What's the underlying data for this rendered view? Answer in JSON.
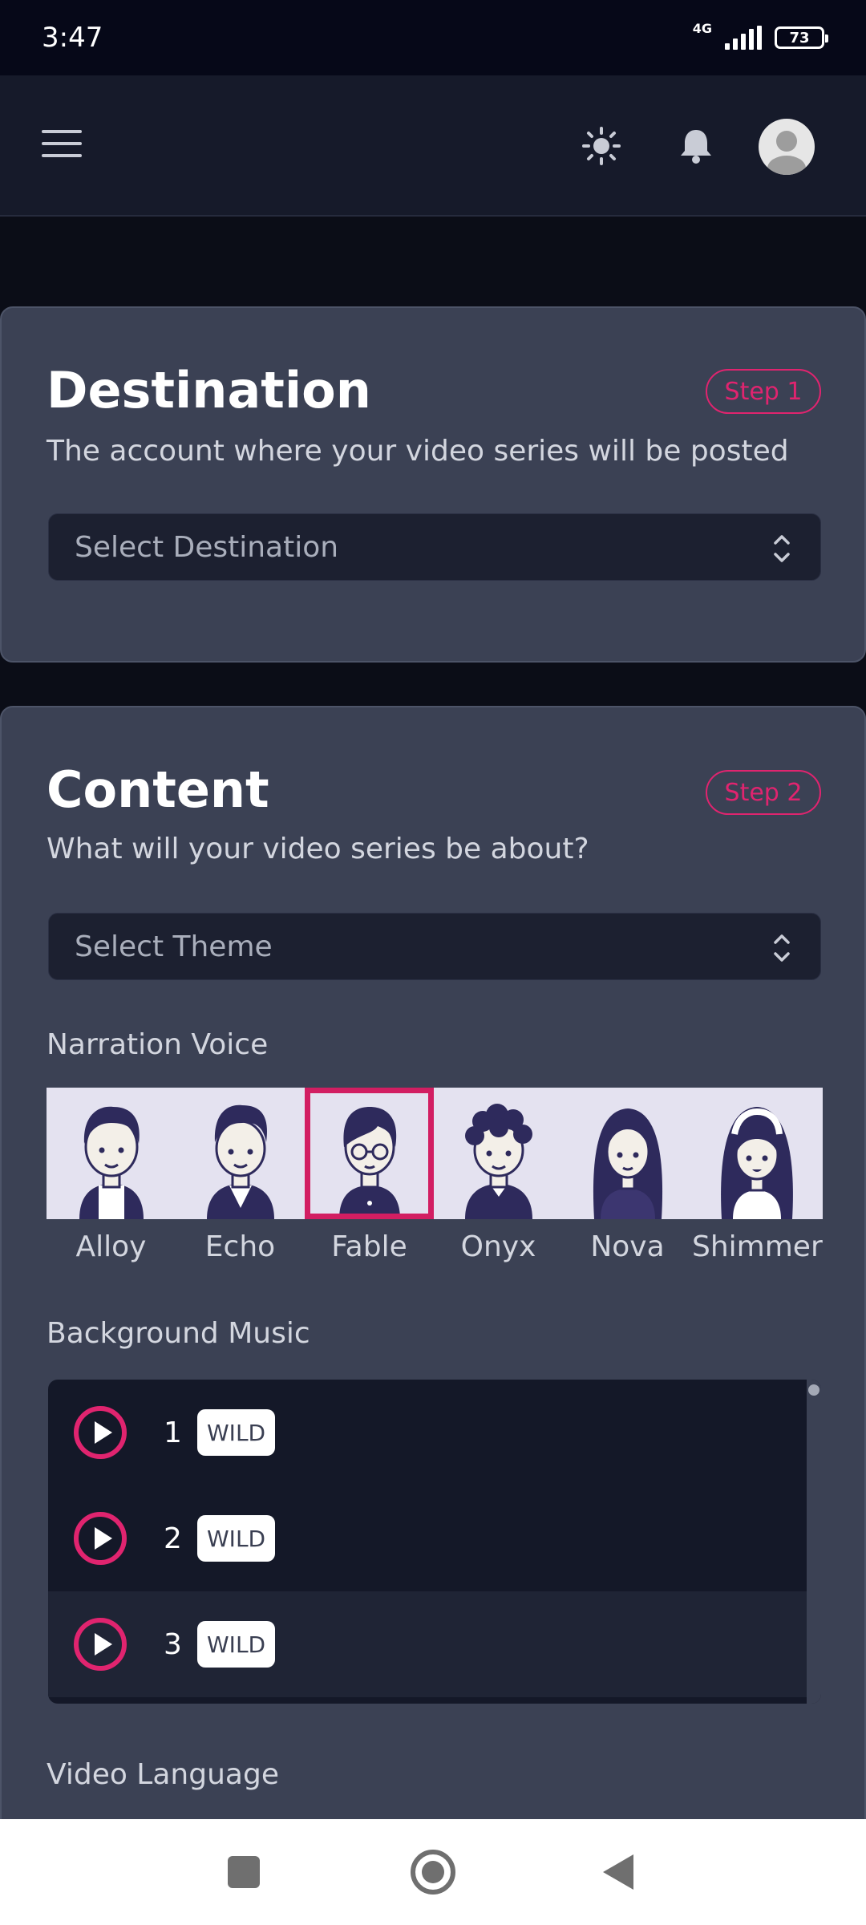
{
  "status_bar": {
    "time": "3:47",
    "network": "4G",
    "battery": "73"
  },
  "header": {
    "icons": [
      "menu-icon",
      "sun-icon",
      "bell-icon",
      "avatar"
    ]
  },
  "destination": {
    "title": "Destination",
    "step": "Step 1",
    "subtitle": "The account where your video series will be posted",
    "select_placeholder": "Select Destination"
  },
  "content": {
    "title": "Content",
    "step": "Step 2",
    "subtitle": "What will your video series be about?",
    "theme_placeholder": "Select Theme",
    "narration_label": "Narration Voice",
    "voices": [
      {
        "name": "Alloy",
        "selected": false
      },
      {
        "name": "Echo",
        "selected": false
      },
      {
        "name": "Fable",
        "selected": true
      },
      {
        "name": "Onyx",
        "selected": false
      },
      {
        "name": "Nova",
        "selected": false
      },
      {
        "name": "Shimmer",
        "selected": false
      }
    ],
    "music_label": "Background Music",
    "tracks": [
      {
        "number": "1",
        "tag": "WILD"
      },
      {
        "number": "2",
        "tag": "WILD"
      },
      {
        "number": "3",
        "tag": "WILD"
      }
    ],
    "language_label": "Video Language"
  },
  "colors": {
    "accent": "#e0246f",
    "card_bg": "#3b4154",
    "page_bg": "#0b0d17"
  }
}
